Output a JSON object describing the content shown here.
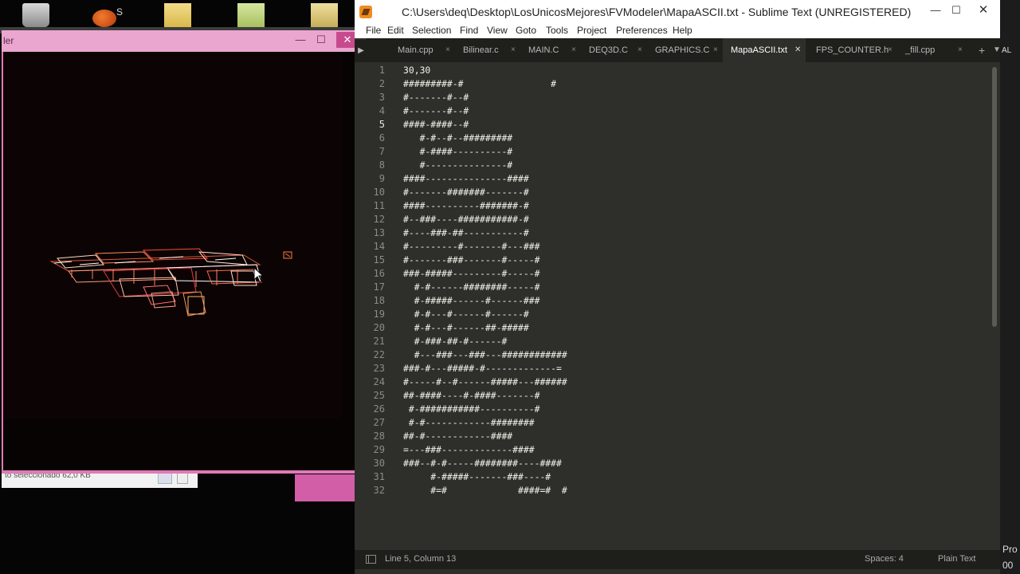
{
  "desktop": {
    "icon_label": "S",
    "explorer_status": "to seleccionado 62,0 KB"
  },
  "modeler": {
    "title": "ler",
    "controls": {
      "minimize": "—",
      "maximize": "☐",
      "close": "✕"
    }
  },
  "sublime": {
    "title": "C:\\Users\\deq\\Desktop\\LosUnicosMejores\\FVModeler\\MapaASCII.txt - Sublime Text (UNREGISTERED)",
    "controls": {
      "minimize": "—",
      "maximize": "☐",
      "close": "✕"
    },
    "menu": [
      "File",
      "Edit",
      "Selection",
      "Find",
      "View",
      "Goto",
      "Tools",
      "Project",
      "Preferences",
      "Help"
    ],
    "tabs": [
      {
        "label": "Main.cpp",
        "active": false
      },
      {
        "label": "Bilinear.c",
        "active": false
      },
      {
        "label": "MAIN.C",
        "active": false
      },
      {
        "label": "DEQ3D.C",
        "active": false
      },
      {
        "label": "GRAPHICS.C",
        "active": false
      },
      {
        "label": "MapaASCII.txt",
        "active": true
      },
      {
        "label": "FPS_COUNTER.h",
        "active": false
      },
      {
        "label": "_fill.cpp",
        "active": false
      }
    ],
    "tab_close_glyph": "×",
    "tab_close_active_glyph": "✕",
    "current_line": 5,
    "lines": [
      "30,30",
      "#########-#                #",
      "#-------#--#",
      "#-------#--#",
      "####-####--#",
      "   #-#--#--#########",
      "   #-####----------#",
      "   #---------------#",
      "####---------------####",
      "#-------#######-------#",
      "####----------#######-#",
      "#--###----###########-#",
      "#----###-##-----------#",
      "#---------#-------#---###",
      "#-------###-------#-----#",
      "###-#####---------#-----#",
      "  #-#------########-----#",
      "  #-#####------#------###",
      "  #-#---#------#------#",
      "  #-#---#------##-#####",
      "  #-###-##-#------#",
      "  #---###---###---############",
      "###-#---#####-#-------------=",
      "#-----#--#------#####---######",
      "##-####----#-####-------#",
      " #-###########----------#",
      " #-#------------########",
      "##-#------------####",
      "=---###-------------####",
      "###--#-#-----########----####",
      "     #-#####-------###----#",
      "     #=#             ####=#  #"
    ],
    "status": {
      "position": "Line 5, Column 13",
      "indent": "Spaces: 4",
      "syntax": "Plain Text"
    }
  },
  "edge": {
    "top_text": "AL",
    "bottom_text_1": "Pro",
    "bottom_text_2": "00"
  },
  "colors": {
    "modeler_frame": "#e07ab6",
    "sublime_bg": "#2e2f2a",
    "sublime_fg": "#f2f2ea"
  }
}
